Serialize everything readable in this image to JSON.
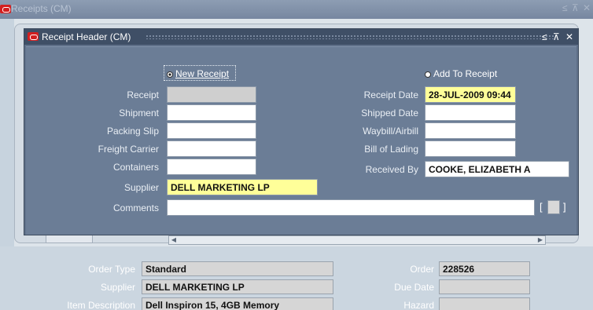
{
  "background_window": {
    "title": "Receipts (CM)",
    "controls": "≤ ⊼ ✕"
  },
  "modal": {
    "title": "Receipt Header (CM)",
    "controls": "≤ ⊼ ✕",
    "radios": {
      "new_receipt": "New Receipt",
      "add_to_receipt": "Add To Receipt",
      "selected": "new_receipt"
    },
    "left_fields": [
      {
        "label": "Receipt",
        "value": ""
      },
      {
        "label": "Shipment",
        "value": ""
      },
      {
        "label": "Packing Slip",
        "value": ""
      },
      {
        "label": "Freight Carrier",
        "value": ""
      },
      {
        "label": "Containers",
        "value": ""
      },
      {
        "label": "Supplier",
        "value": "DELL MARKETING LP"
      }
    ],
    "right_fields": [
      {
        "label": "Receipt Date",
        "value": "28-JUL-2009 09:44"
      },
      {
        "label": "Shipped Date",
        "value": ""
      },
      {
        "label": "Waybill/Airbill",
        "value": ""
      },
      {
        "label": "Bill of Lading",
        "value": ""
      },
      {
        "label": "Received By",
        "value": "COOKE, ELIZABETH A"
      }
    ],
    "comments": {
      "label": "Comments",
      "value": ""
    },
    "bracket_open": "[",
    "bracket_close": "]"
  },
  "order_info": {
    "order_type_label": "Order Type",
    "order_type": "Standard",
    "supplier_label": "Supplier",
    "supplier": "DELL MARKETING LP",
    "item_description_label": "Item Description",
    "item_description": "Dell Inspiron 15, 4GB Memory",
    "order_label": "Order",
    "order": "228526",
    "due_date_label": "Due Date",
    "due_date": "",
    "hazard_label": "Hazard",
    "hazard": ""
  },
  "colors": {
    "modal_bg": "#6b7d96",
    "titlebar": "#3f4f66",
    "required_field": "#ffff99",
    "disabled_field": "#cfcfcf"
  }
}
